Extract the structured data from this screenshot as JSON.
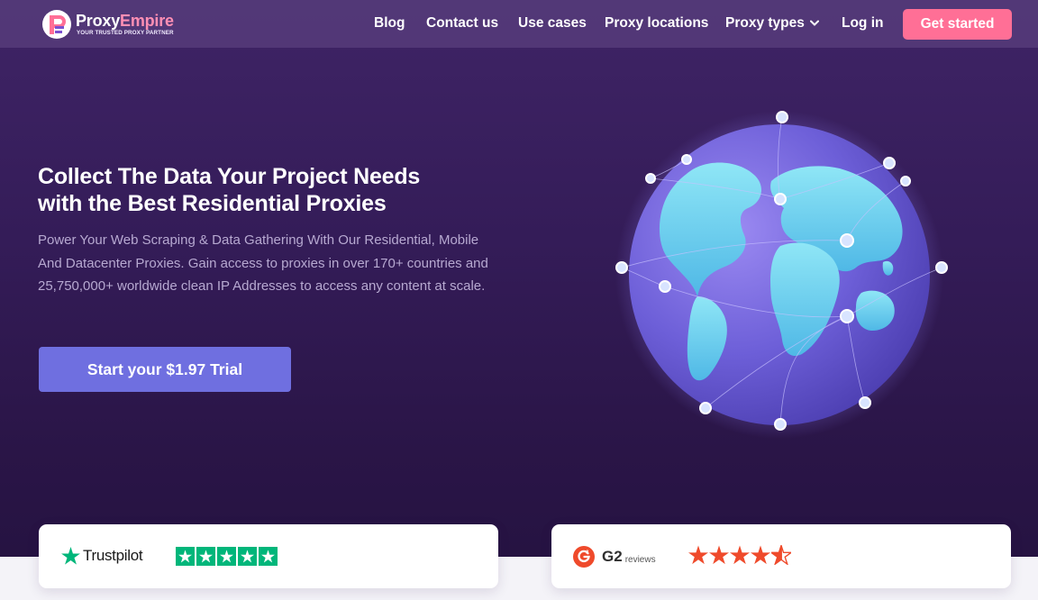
{
  "brand": {
    "name_part1": "Proxy",
    "name_part2": "Empire",
    "tagline": "YOUR TRUSTED PROXY PARTNER",
    "accent": "#ff6f96",
    "primary": "#6f6fe0"
  },
  "nav": {
    "items": [
      {
        "label": "Blog"
      },
      {
        "label": "Contact us"
      },
      {
        "label": "Use cases"
      },
      {
        "label": "Proxy locations"
      },
      {
        "label": "Proxy types"
      },
      {
        "label": "Log in"
      }
    ],
    "cta_label": "Get started"
  },
  "hero": {
    "title_line1": "Collect The Data Your Project Needs",
    "title_line2": "with the Best Residential Proxies",
    "subtitle": "Power Your Web Scraping & Data Gathering With Our Residential, Mobile And Datacenter Proxies. Gain access to proxies in over 170+ countries and 25,750,000+ worldwide clean IP Addresses to access any content at scale.",
    "cta_label": "Start your $1.97 Trial",
    "illustration": "globe-network-icon"
  },
  "reviews": {
    "trustpilot": {
      "name": "Trustpilot",
      "stars": 5,
      "icon": "trustpilot-star-icon"
    },
    "g2": {
      "name": "G2",
      "suffix": "reviews",
      "stars": 4.5,
      "icon": "g2-logo-icon"
    }
  }
}
